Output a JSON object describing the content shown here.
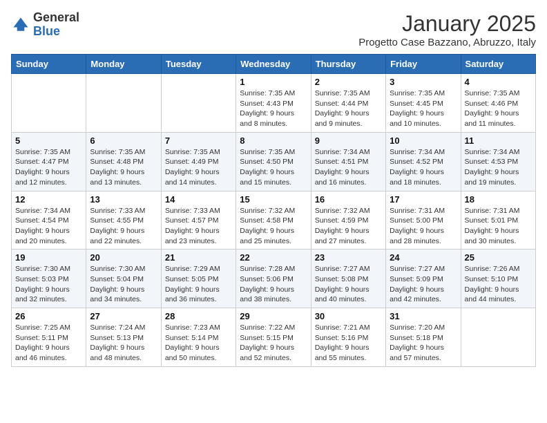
{
  "header": {
    "logo_general": "General",
    "logo_blue": "Blue",
    "month_title": "January 2025",
    "subtitle": "Progetto Case Bazzano, Abruzzo, Italy"
  },
  "weekdays": [
    "Sunday",
    "Monday",
    "Tuesday",
    "Wednesday",
    "Thursday",
    "Friday",
    "Saturday"
  ],
  "weeks": [
    [
      {
        "day": "",
        "info": ""
      },
      {
        "day": "",
        "info": ""
      },
      {
        "day": "",
        "info": ""
      },
      {
        "day": "1",
        "info": "Sunrise: 7:35 AM\nSunset: 4:43 PM\nDaylight: 9 hours and 8 minutes."
      },
      {
        "day": "2",
        "info": "Sunrise: 7:35 AM\nSunset: 4:44 PM\nDaylight: 9 hours and 9 minutes."
      },
      {
        "day": "3",
        "info": "Sunrise: 7:35 AM\nSunset: 4:45 PM\nDaylight: 9 hours and 10 minutes."
      },
      {
        "day": "4",
        "info": "Sunrise: 7:35 AM\nSunset: 4:46 PM\nDaylight: 9 hours and 11 minutes."
      }
    ],
    [
      {
        "day": "5",
        "info": "Sunrise: 7:35 AM\nSunset: 4:47 PM\nDaylight: 9 hours and 12 minutes."
      },
      {
        "day": "6",
        "info": "Sunrise: 7:35 AM\nSunset: 4:48 PM\nDaylight: 9 hours and 13 minutes."
      },
      {
        "day": "7",
        "info": "Sunrise: 7:35 AM\nSunset: 4:49 PM\nDaylight: 9 hours and 14 minutes."
      },
      {
        "day": "8",
        "info": "Sunrise: 7:35 AM\nSunset: 4:50 PM\nDaylight: 9 hours and 15 minutes."
      },
      {
        "day": "9",
        "info": "Sunrise: 7:34 AM\nSunset: 4:51 PM\nDaylight: 9 hours and 16 minutes."
      },
      {
        "day": "10",
        "info": "Sunrise: 7:34 AM\nSunset: 4:52 PM\nDaylight: 9 hours and 18 minutes."
      },
      {
        "day": "11",
        "info": "Sunrise: 7:34 AM\nSunset: 4:53 PM\nDaylight: 9 hours and 19 minutes."
      }
    ],
    [
      {
        "day": "12",
        "info": "Sunrise: 7:34 AM\nSunset: 4:54 PM\nDaylight: 9 hours and 20 minutes."
      },
      {
        "day": "13",
        "info": "Sunrise: 7:33 AM\nSunset: 4:55 PM\nDaylight: 9 hours and 22 minutes."
      },
      {
        "day": "14",
        "info": "Sunrise: 7:33 AM\nSunset: 4:57 PM\nDaylight: 9 hours and 23 minutes."
      },
      {
        "day": "15",
        "info": "Sunrise: 7:32 AM\nSunset: 4:58 PM\nDaylight: 9 hours and 25 minutes."
      },
      {
        "day": "16",
        "info": "Sunrise: 7:32 AM\nSunset: 4:59 PM\nDaylight: 9 hours and 27 minutes."
      },
      {
        "day": "17",
        "info": "Sunrise: 7:31 AM\nSunset: 5:00 PM\nDaylight: 9 hours and 28 minutes."
      },
      {
        "day": "18",
        "info": "Sunrise: 7:31 AM\nSunset: 5:01 PM\nDaylight: 9 hours and 30 minutes."
      }
    ],
    [
      {
        "day": "19",
        "info": "Sunrise: 7:30 AM\nSunset: 5:03 PM\nDaylight: 9 hours and 32 minutes."
      },
      {
        "day": "20",
        "info": "Sunrise: 7:30 AM\nSunset: 5:04 PM\nDaylight: 9 hours and 34 minutes."
      },
      {
        "day": "21",
        "info": "Sunrise: 7:29 AM\nSunset: 5:05 PM\nDaylight: 9 hours and 36 minutes."
      },
      {
        "day": "22",
        "info": "Sunrise: 7:28 AM\nSunset: 5:06 PM\nDaylight: 9 hours and 38 minutes."
      },
      {
        "day": "23",
        "info": "Sunrise: 7:27 AM\nSunset: 5:08 PM\nDaylight: 9 hours and 40 minutes."
      },
      {
        "day": "24",
        "info": "Sunrise: 7:27 AM\nSunset: 5:09 PM\nDaylight: 9 hours and 42 minutes."
      },
      {
        "day": "25",
        "info": "Sunrise: 7:26 AM\nSunset: 5:10 PM\nDaylight: 9 hours and 44 minutes."
      }
    ],
    [
      {
        "day": "26",
        "info": "Sunrise: 7:25 AM\nSunset: 5:11 PM\nDaylight: 9 hours and 46 minutes."
      },
      {
        "day": "27",
        "info": "Sunrise: 7:24 AM\nSunset: 5:13 PM\nDaylight: 9 hours and 48 minutes."
      },
      {
        "day": "28",
        "info": "Sunrise: 7:23 AM\nSunset: 5:14 PM\nDaylight: 9 hours and 50 minutes."
      },
      {
        "day": "29",
        "info": "Sunrise: 7:22 AM\nSunset: 5:15 PM\nDaylight: 9 hours and 52 minutes."
      },
      {
        "day": "30",
        "info": "Sunrise: 7:21 AM\nSunset: 5:16 PM\nDaylight: 9 hours and 55 minutes."
      },
      {
        "day": "31",
        "info": "Sunrise: 7:20 AM\nSunset: 5:18 PM\nDaylight: 9 hours and 57 minutes."
      },
      {
        "day": "",
        "info": ""
      }
    ]
  ]
}
